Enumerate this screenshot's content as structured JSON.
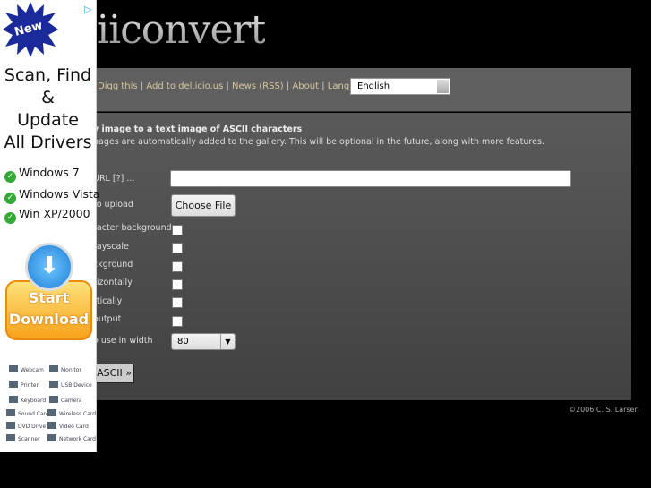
{
  "header": {
    "logo": "iiconvert"
  },
  "nav": {
    "links": [
      "Digg this",
      "Add to del.icio.us",
      "News (RSS)",
      "About",
      "Language /"
    ],
    "language": "English"
  },
  "main": {
    "title": "y image to a text image of ASCII characters",
    "note": "nages are automatically added to the gallery. This will be optional in the future, along with more features.",
    "url_label": "URL [?] ...",
    "upload_label": "to upload",
    "choose_file": "Choose File",
    "options": [
      {
        "label": "racter background",
        "checked": false
      },
      {
        "label": "rayscale",
        "checked": false
      },
      {
        "label": "ckground",
        "checked": false
      },
      {
        "label": "rizontally",
        "checked": false
      },
      {
        "label": "rtically",
        "checked": false
      },
      {
        "label": "output",
        "checked": false
      }
    ],
    "width_label": "o use in width",
    "width_value": "80",
    "submit": "ASCII »"
  },
  "footer": {
    "copyright": "©2006 C. S. Larsen"
  },
  "ad": {
    "badge": "New",
    "headline": [
      "Scan, Find",
      "&",
      "Update",
      "All Drivers"
    ],
    "os": [
      "Windows 7",
      "Windows Vista",
      "Win XP/2000"
    ],
    "button": [
      "Start",
      "Download"
    ],
    "devices": [
      "Webcam",
      "Monitor",
      "Printer",
      "USB Device",
      "Keyboard",
      "Camera",
      "Sound Card",
      "Wireless Card",
      "DVD Drive",
      "Video Card",
      "Scanner",
      "Network Card"
    ]
  }
}
